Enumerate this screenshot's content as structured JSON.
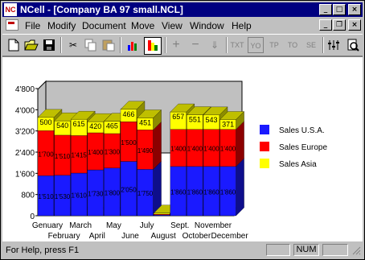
{
  "window": {
    "app_icon_text": "NC",
    "title": "NCell - [Company BA 97 small.NCL]",
    "buttons": {
      "minimize": "_",
      "maximize": "□",
      "close": "×"
    }
  },
  "menu": {
    "items": [
      "File",
      "Modify",
      "Document",
      "Move",
      "View",
      "Window",
      "Help"
    ],
    "mdi_buttons": {
      "minimize": "_",
      "restore": "❐",
      "close": "×"
    }
  },
  "toolbar": {
    "icons": [
      "new-document-icon",
      "open-folder-icon",
      "save-icon",
      "cut-icon",
      "copy-icon",
      "paste-icon",
      "chart-bars-icon",
      "chart-color-icon",
      "plus-icon",
      "minus-icon",
      "down-arrow-icon",
      "txt-icon",
      "yo-icon",
      "tp-icon",
      "to-icon",
      "se-icon",
      "tuner-icon",
      "print-preview-icon"
    ],
    "text_buttons": {
      "txt": "TXT",
      "yo": "YO",
      "tp": "TP",
      "to": "TO",
      "se": "SE"
    }
  },
  "chart_data": {
    "type": "bar",
    "stacked": true,
    "three_d": true,
    "categories": [
      "Genuary",
      "February",
      "March",
      "April",
      "May",
      "June",
      "July",
      "August",
      "Sept.",
      "October",
      "November",
      "December"
    ],
    "series": [
      {
        "name": "Sales U.S.A.",
        "color": "#1a1aff",
        "values": [
          1510,
          1530,
          1610,
          1730,
          1800,
          2050,
          1750,
          30,
          1860,
          1860,
          1860,
          1860
        ],
        "labels": [
          "1'510",
          "1'530",
          "1'610",
          "1'730",
          "1'800",
          "2'050",
          "1'750",
          "",
          "1'860",
          "1'860",
          "1'860",
          "1'860"
        ]
      },
      {
        "name": "Sales Europe",
        "color": "#ff0000",
        "values": [
          1700,
          1510,
          1415,
          1400,
          1300,
          1500,
          1490,
          30,
          1400,
          1400,
          1400,
          1400
        ],
        "labels": [
          "1'700",
          "1'510",
          "1'415",
          "1'400",
          "1'300",
          "1'500",
          "1'490",
          "",
          "1'400",
          "1'400",
          "1'400",
          "1'400"
        ]
      },
      {
        "name": "Sales Asia",
        "color": "#ffff00",
        "values": [
          500,
          540,
          615,
          420,
          465,
          466,
          451,
          40,
          657,
          551,
          543,
          371
        ],
        "labels": [
          "500",
          "540",
          "615",
          "420",
          "465",
          "466",
          "451",
          "",
          "657",
          "551",
          "543",
          "371"
        ]
      }
    ],
    "yticks": [
      "0",
      "800",
      "1'600",
      "2'400",
      "3'200",
      "4'000",
      "4'800"
    ],
    "ylim": [
      0,
      4800
    ],
    "grid": false,
    "legend": "right"
  },
  "status": {
    "text": "For Help, press F1",
    "num": "NUM"
  }
}
